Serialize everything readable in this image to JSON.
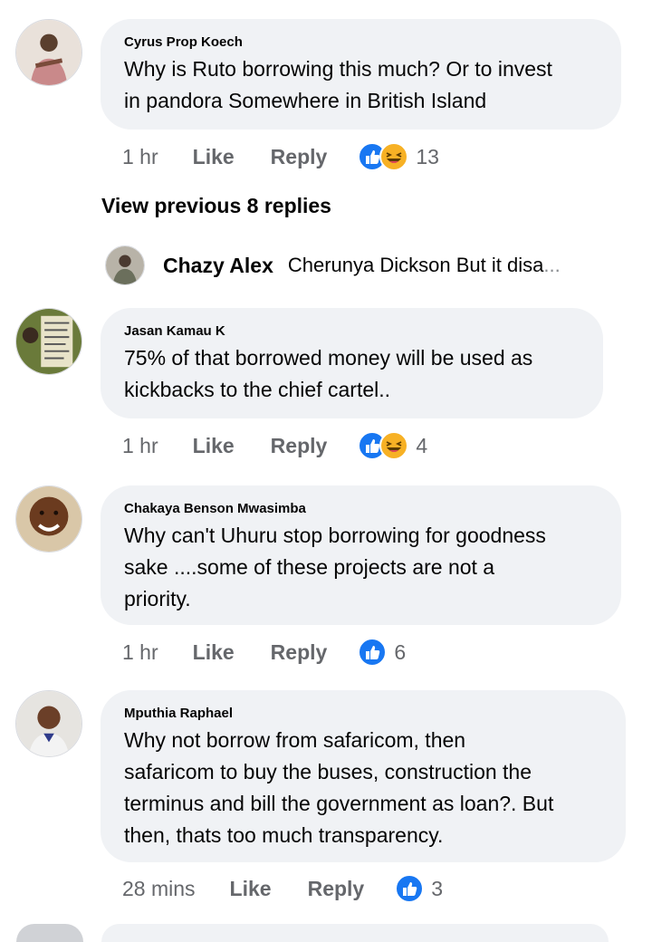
{
  "comments": [
    {
      "author": "Cyrus Prop Koech",
      "lines": [
        "Why is Ruto borrowing this much? Or to invest",
        "in pandora Somewhere in British Island"
      ],
      "time": "1 hr",
      "like_label": "Like",
      "reply_label": "Reply",
      "reaction_count": "13",
      "reactions": [
        "like-icon",
        "haha-icon"
      ]
    },
    {
      "author": "Jasan Kamau K",
      "lines": [
        "75% of that borrowed money will be used as",
        "kickbacks to the chief cartel.."
      ],
      "time": "1 hr",
      "like_label": "Like",
      "reply_label": "Reply",
      "reaction_count": "4",
      "reactions": [
        "like-icon",
        "haha-icon"
      ]
    },
    {
      "author": "Chakaya Benson Mwasimba",
      "lines": [
        "Why can't Uhuru stop borrowing for goodness",
        "sake ....some of these projects are not a",
        "priority."
      ],
      "time": "1 hr",
      "like_label": "Like",
      "reply_label": "Reply",
      "reaction_count": "6",
      "reactions": [
        "like-icon"
      ]
    },
    {
      "author": "Mputhia Raphael",
      "lines": [
        "Why not borrow from safaricom,  then",
        "safaricom to buy the buses, construction the",
        "terminus and bill the government as loan?.  But",
        "then, thats too much transparency."
      ],
      "time": "28 mins",
      "like_label": "Like",
      "reply_label": "Reply",
      "reaction_count": "3",
      "reactions": [
        "like-icon"
      ]
    }
  ],
  "view_previous": "View previous 8 replies",
  "reply_preview": {
    "author": "Chazy Alex",
    "text": "Cherunya Dickson But it disa",
    "ellipsis": "..."
  },
  "colors": {
    "bubble": "#f0f2f5",
    "meta_text": "#65676b",
    "like_blue": "#1877f2",
    "haha_yellow": "#f7b125"
  }
}
